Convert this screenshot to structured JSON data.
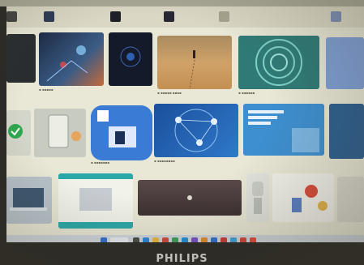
{
  "photo": {
    "subject": "photo-of-monitor-showing-image-search-grid",
    "device_brand": "PHILIPS"
  },
  "colors": {
    "screen_bg": "#e9e7d6",
    "bezel": "#2b2a26",
    "accent_blue": "#3a7bd5",
    "teal": "#2aa8a8"
  },
  "tiles": [
    {
      "name": "cyber-hand",
      "icon": "hand-network-image"
    },
    {
      "name": "dark-tech",
      "icon": "circuit-image"
    },
    {
      "name": "desert-walker",
      "icon": "desert-image"
    },
    {
      "name": "teal-rings",
      "icon": "rings-image"
    },
    {
      "name": "checkmark",
      "icon": "check-icon"
    },
    {
      "name": "blue-device",
      "icon": "device-image"
    },
    {
      "name": "network-map",
      "icon": "network-image"
    },
    {
      "name": "blue-banner",
      "icon": "banner-image"
    },
    {
      "name": "laptop",
      "icon": "laptop-image"
    },
    {
      "name": "person-screen",
      "icon": "presentation-image"
    },
    {
      "name": "video-dark",
      "icon": "play-icon"
    },
    {
      "name": "robots",
      "icon": "robot-image"
    }
  ]
}
